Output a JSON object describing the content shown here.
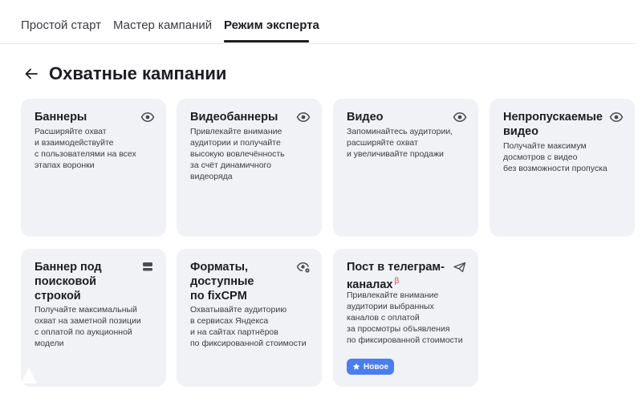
{
  "tabs": [
    {
      "label": "Простой старт"
    },
    {
      "label": "Мастер кампаний"
    },
    {
      "label": "Режим эксперта"
    }
  ],
  "active_tab": "Режим эксперта",
  "page": {
    "title": "Охватные кампании"
  },
  "cards": [
    {
      "title": "Баннеры",
      "description": "Расширяйте охват\nи взаимодействуйте\nс пользователями на всех\nэтапах воронки",
      "icon": "eye-icon"
    },
    {
      "title": "Видеобаннеры",
      "description": "Привлекайте внимание\nаудитории и получайте\nвысокую вовлечённость\nза счёт динамичного\nвидеоряда",
      "icon": "eye-icon"
    },
    {
      "title": "Видео",
      "description": "Запоминайтесь аудитории,\nрасширяйте охват\nи увеличивайте продажи",
      "icon": "eye-icon"
    },
    {
      "title": "Непропускаемые видео",
      "description": "Получайте максимум\nдосмотров с видео\nбез возможности пропуска",
      "icon": "eye-icon"
    },
    {
      "title": "Баннер под поисковой строкой",
      "description": "Получайте максимальный\nохват на заметной позиции\nс оплатой по аукционной\nмодели",
      "icon": "banner-layout-icon"
    },
    {
      "title": "Форматы, доступные по fixCPM",
      "description": "Охватывайте аудиторию\nв сервисах Яндекса\nи на сайтах партнёров\nпо фиксированной стоимости",
      "icon": "eye-settings-icon"
    },
    {
      "title": "Пост в телеграм-каналах",
      "beta": "β",
      "description": "Привлекайте внимание\nаудитории выбранных\nканалов с оплатой\nза просмотры объявления\nпо фиксированной стоимости",
      "icon": "telegram-plane-icon",
      "badge": "Новое"
    }
  ],
  "colors": {
    "card_bg": "#f1f2f5",
    "badge_bg": "#4a7df0",
    "beta": "#e53935",
    "text": "#1c1d22"
  }
}
